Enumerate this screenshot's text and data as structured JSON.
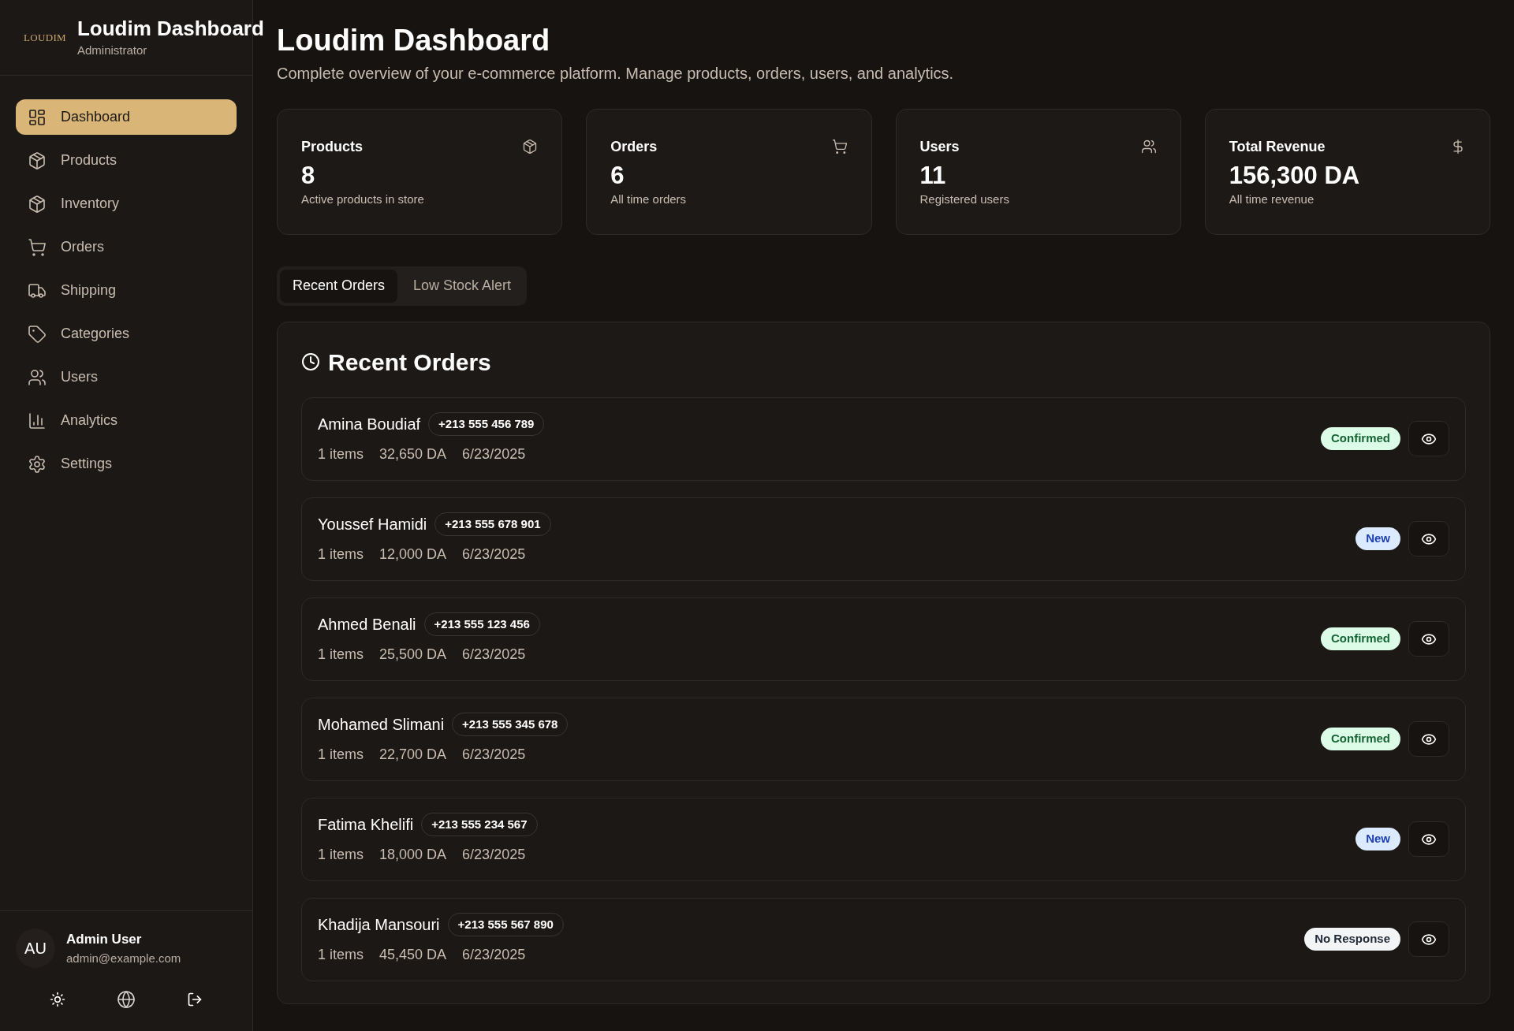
{
  "sidebar": {
    "logo": "LOUDIM",
    "title": "Loudim Dashboard",
    "subtitle": "Administrator",
    "items": [
      {
        "label": "Dashboard",
        "selected": true
      },
      {
        "label": "Products",
        "selected": false
      },
      {
        "label": "Inventory",
        "selected": false
      },
      {
        "label": "Orders",
        "selected": false
      },
      {
        "label": "Shipping",
        "selected": false
      },
      {
        "label": "Categories",
        "selected": false
      },
      {
        "label": "Users",
        "selected": false
      },
      {
        "label": "Analytics",
        "selected": false
      },
      {
        "label": "Settings",
        "selected": false
      }
    ],
    "user": {
      "initials": "AU",
      "name": "Admin User",
      "email": "admin@example.com"
    }
  },
  "header": {
    "title": "Loudim Dashboard",
    "subtitle": "Complete overview of your e-commerce platform. Manage products, orders, users, and analytics."
  },
  "stats": [
    {
      "label": "Products",
      "value": "8",
      "caption": "Active products in store"
    },
    {
      "label": "Orders",
      "value": "6",
      "caption": "All time orders"
    },
    {
      "label": "Users",
      "value": "11",
      "caption": "Registered users"
    },
    {
      "label": "Total Revenue",
      "value": "156,300 DA",
      "caption": "All time revenue"
    }
  ],
  "tabs": [
    {
      "label": "Recent Orders",
      "selected": true
    },
    {
      "label": "Low Stock Alert",
      "selected": false
    }
  ],
  "recent_orders": {
    "title": "Recent Orders",
    "orders": [
      {
        "name": "Amina Boudiaf",
        "phone": "+213 555 456 789",
        "items": "1 items",
        "total": "32,650 DA",
        "date": "6/23/2025",
        "status": "Confirmed",
        "kind": "confirmed"
      },
      {
        "name": "Youssef Hamidi",
        "phone": "+213 555 678 901",
        "items": "1 items",
        "total": "12,000 DA",
        "date": "6/23/2025",
        "status": "New",
        "kind": "new"
      },
      {
        "name": "Ahmed Benali",
        "phone": "+213 555 123 456",
        "items": "1 items",
        "total": "25,500 DA",
        "date": "6/23/2025",
        "status": "Confirmed",
        "kind": "confirmed"
      },
      {
        "name": "Mohamed Slimani",
        "phone": "+213 555 345 678",
        "items": "1 items",
        "total": "22,700 DA",
        "date": "6/23/2025",
        "status": "Confirmed",
        "kind": "confirmed"
      },
      {
        "name": "Fatima Khelifi",
        "phone": "+213 555 234 567",
        "items": "1 items",
        "total": "18,000 DA",
        "date": "6/23/2025",
        "status": "New",
        "kind": "new"
      },
      {
        "name": "Khadija Mansouri",
        "phone": "+213 555 567 890",
        "items": "1 items",
        "total": "45,450 DA",
        "date": "6/23/2025",
        "status": "No Response",
        "kind": "no_response"
      }
    ]
  }
}
